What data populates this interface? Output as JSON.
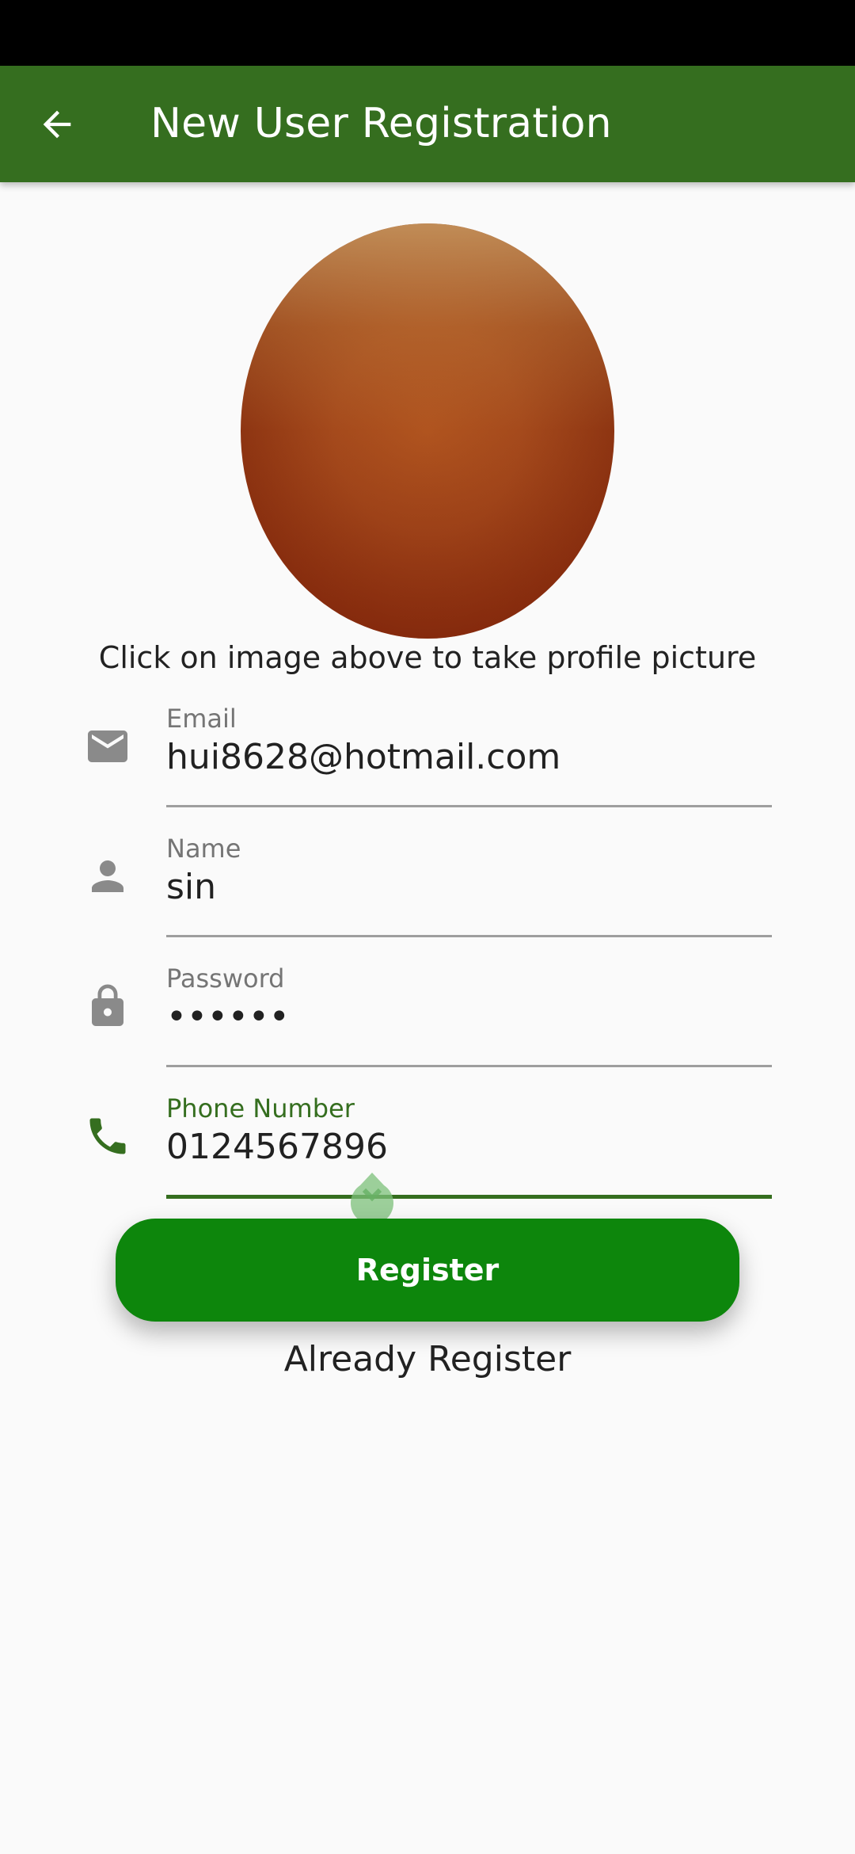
{
  "app_bar": {
    "title": "New User Registration",
    "back_icon": "arrow-back-icon",
    "color": "#356e1f"
  },
  "profile": {
    "hint": "Click on image above to take profile picture"
  },
  "fields": {
    "email": {
      "label": "Email",
      "value": "hui8628@hotmail.com",
      "icon": "mail-icon"
    },
    "name": {
      "label": "Name",
      "value": "sin",
      "icon": "person-icon"
    },
    "password": {
      "label": "Password",
      "value": "••••••",
      "icon": "lock-icon"
    },
    "phone": {
      "label": "Phone Number",
      "value": "0124567896",
      "icon": "phone-icon",
      "focused": true
    }
  },
  "actions": {
    "register_label": "Register",
    "register_color": "#0d860c",
    "already_label": "Already Register"
  }
}
